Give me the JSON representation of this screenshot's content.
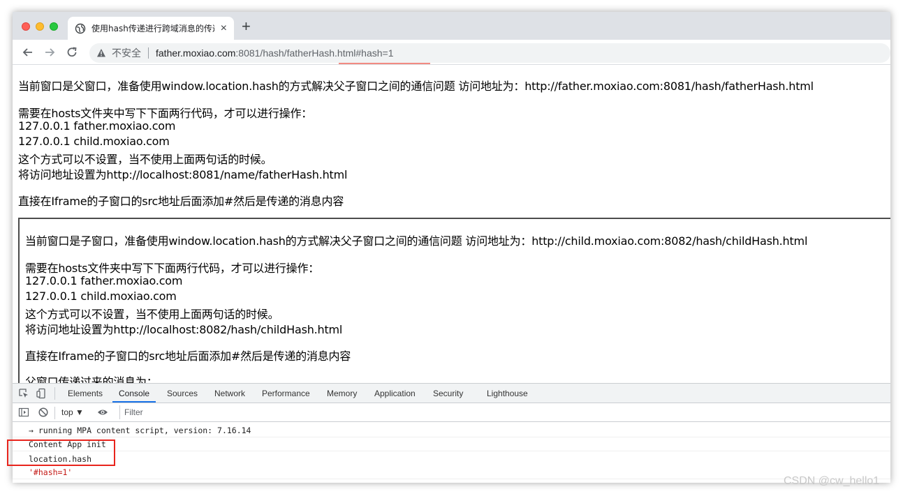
{
  "tab": {
    "title": "使用hash传递进行跨域消息的传递",
    "favicon": "globe-icon",
    "close_label": "×",
    "new_tab_label": "+"
  },
  "toolbar": {
    "insecure_label": "不安全",
    "url_host": "father.moxiao.com",
    "url_rest": ":8081/hash/fatherHash.html#hash=1"
  },
  "page": {
    "line1": "当前窗口是父窗口，准备使用window.location.hash的方式解决父子窗口之间的通信问题 访问地址为：http://father.moxiao.com:8081/hash/fatherHash.html",
    "hosts_intro": "需要在hosts文件夹中写下下面两行代码，才可以进行操作：",
    "hosts_line1": "127.0.0.1 father.moxiao.com",
    "hosts_line2": "127.0.0.1 child.moxiao.com",
    "note": "这个方式可以不设置，当不使用上面两句话的时候。",
    "local_url": "将访问地址设置为http://localhost:8081/name/fatherHash.html",
    "iframe_hint": "直接在Iframe的子窗口的src地址后面添加#然后是传递的消息内容"
  },
  "iframe": {
    "line1": "当前窗口是子窗口，准备使用window.location.hash的方式解决父子窗口之间的通信问题 访问地址为：http://child.moxiao.com:8082/hash/childHash.html",
    "hosts_intro": "需要在hosts文件夹中写下下面两行代码，才可以进行操作：",
    "hosts_line1": "127.0.0.1 father.moxiao.com",
    "hosts_line2": "127.0.0.1 child.moxiao.com",
    "note": "这个方式可以不设置，当不使用上面两句话的时候。",
    "local_url": "将访问地址设置为http://localhost:8082/hash/childHash.html",
    "iframe_hint": "直接在Iframe的子窗口的src地址后面添加#然后是传递的消息内容",
    "parent_msg": "父窗口传递过来的消息为："
  },
  "devtools": {
    "tabs": [
      "Elements",
      "Console",
      "Sources",
      "Network",
      "Performance",
      "Memory",
      "Application",
      "Security",
      "Lighthouse"
    ],
    "active_tab": "Console",
    "context": "top ▼",
    "filter_placeholder": "Filter",
    "console": {
      "line1": "→ running MPA content script, version: 7.16.14",
      "line2": "Content App init",
      "input": "location.hash",
      "result": "'#hash=1'"
    }
  },
  "watermark": "CSDN @cw_hello1"
}
